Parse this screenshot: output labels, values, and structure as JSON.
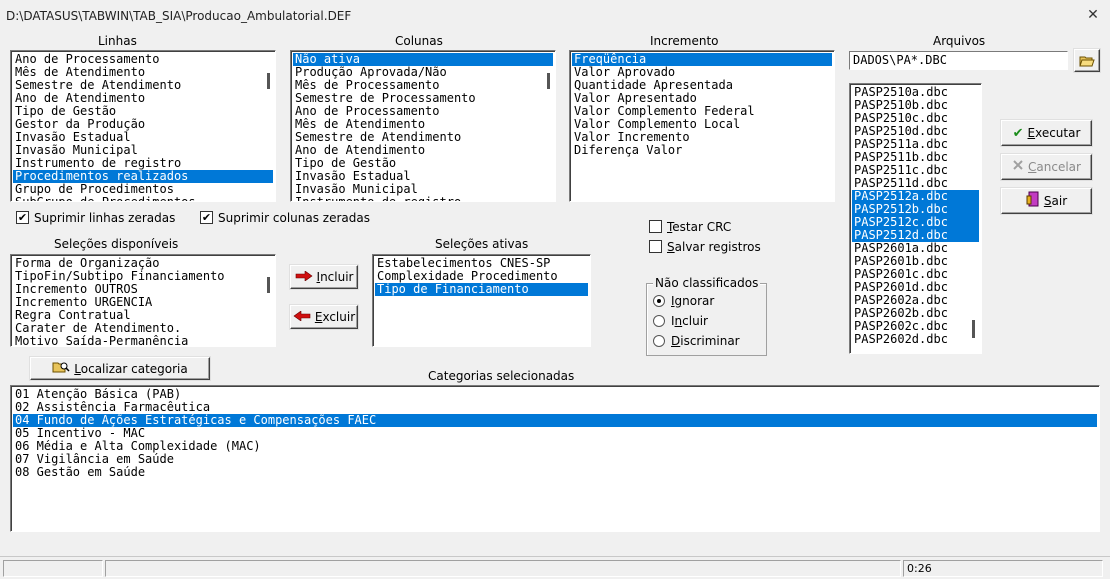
{
  "window": {
    "title": "D:\\DATASUS\\TABWIN\\TAB_SIA\\Producao_Ambulatorial.DEF",
    "close_glyph": "✕"
  },
  "labels": {
    "linhas": "Linhas",
    "colunas": "Colunas",
    "incremento": "Incremento",
    "arquivos": "Arquivos",
    "selecoes_disponiveis": "Seleções disponíveis",
    "selecoes_ativas": "Seleções ativas",
    "categorias_selecionadas": "Categorias selecionadas"
  },
  "linhas": {
    "items": [
      "Ano de Processamento",
      "Mês de Atendimento",
      "Semestre de Atendimento",
      "Ano de Atendimento",
      "Tipo de Gestão",
      "Gestor da Produção",
      "Invasão Estadual",
      "Invasão Municipal",
      "Instrumento de registro",
      "Procedimentos realizados",
      "Grupo de Procedimentos",
      "SubGrupo de Procedimentos"
    ],
    "selected_index": 9
  },
  "colunas": {
    "items": [
      "Não ativa",
      "Produção Aprovada/Não",
      "Mês de Processamento",
      "Semestre de Processamento",
      "Ano de Processamento",
      "Mês de Atendimento",
      "Semestre de Atendimento",
      "Ano de Atendimento",
      "Tipo de Gestão",
      "Invasão Estadual",
      "Invasão Municipal",
      "Instrumento de registro"
    ],
    "selected_index": 0
  },
  "incremento": {
    "items": [
      "Freqüência",
      "Valor Aprovado",
      "Quantidade Apresentada",
      "Valor Apresentado",
      "Valor Complemento Federal",
      "Valor Complemento Local",
      "Valor Incremento",
      "Diferença Valor"
    ],
    "selected_index": 0
  },
  "arquivos": {
    "filter_value": "DADOS\\PA*.DBC",
    "folder_icon": "open-folder-icon",
    "files": [
      "PASP2510a.dbc",
      "PASP2510b.dbc",
      "PASP2510c.dbc",
      "PASP2510d.dbc",
      "PASP2511a.dbc",
      "PASP2511b.dbc",
      "PASP2511c.dbc",
      "PASP2511d.dbc",
      "PASP2512a.dbc",
      "PASP2512b.dbc",
      "PASP2512c.dbc",
      "PASP2512d.dbc",
      "PASP2601a.dbc",
      "PASP2601b.dbc",
      "PASP2601c.dbc",
      "PASP2601d.dbc",
      "PASP2602a.dbc",
      "PASP2602b.dbc",
      "PASP2602c.dbc",
      "PASP2602d.dbc"
    ],
    "selected_indices": [
      8,
      9,
      10,
      11
    ]
  },
  "buttons": {
    "executar": {
      "pre": "",
      "ul": "E",
      "post": "xecutar"
    },
    "cancelar": {
      "pre": "",
      "ul": "C",
      "post": "ancelar"
    },
    "sair": {
      "pre": "",
      "ul": "S",
      "post": "air"
    },
    "incluir": {
      "pre": "",
      "ul": "I",
      "post": "ncluir"
    },
    "excluir": {
      "pre": "",
      "ul": "E",
      "post": "xcluir"
    },
    "localizar": {
      "pre": "",
      "ul": "L",
      "post": "ocalizar categoria"
    }
  },
  "checkboxes": {
    "suprimir_linhas": {
      "label": "Suprimir linhas zeradas",
      "checked": true
    },
    "suprimir_colunas": {
      "label": "Suprimir colunas zeradas",
      "checked": true
    },
    "testar_crc": {
      "pre": "",
      "ul": "T",
      "post": "estar CRC",
      "checked": false
    },
    "salvar_registros": {
      "pre": "",
      "ul": "S",
      "post": "alvar registros",
      "checked": false
    }
  },
  "check_glyph": "✔",
  "nao_classificados": {
    "title": "Não classificados",
    "options": [
      {
        "pre": "",
        "ul": "I",
        "post": "gnorar",
        "selected": true
      },
      {
        "pre": "I",
        "ul": "n",
        "post": "cluir",
        "selected": false
      },
      {
        "pre": "",
        "ul": "D",
        "post": "iscriminar",
        "selected": false
      }
    ]
  },
  "selecoes_disponiveis": {
    "items": [
      "Forma de  Organização",
      "TipoFin/Subtipo Financiamento",
      "Incremento OUTROS",
      "Incremento URGENCIA",
      "Regra Contratual",
      "Carater de Atendimento.",
      "Motivo Saída-Permanência"
    ]
  },
  "selecoes_ativas": {
    "items": [
      "Estabelecimentos CNES-SP",
      "Complexidade Procedimento",
      "Tipo de Financiamento"
    ],
    "selected_index": 2
  },
  "categorias": {
    "items": [
      "01 Atenção Básica (PAB)",
      "02 Assistência Farmacêutica",
      "04 Fundo de Ações Estratégicas e Compensações FAEC",
      "05 Incentivo - MAC",
      "06 Média e Alta Complexidade (MAC)",
      "07 Vigilância em Saúde",
      "08 Gestão em Saúde"
    ],
    "selected_index": 2
  },
  "status": {
    "time": "0:26"
  },
  "colors": {
    "selection": "#0078d7",
    "face": "#f0f0f0"
  }
}
